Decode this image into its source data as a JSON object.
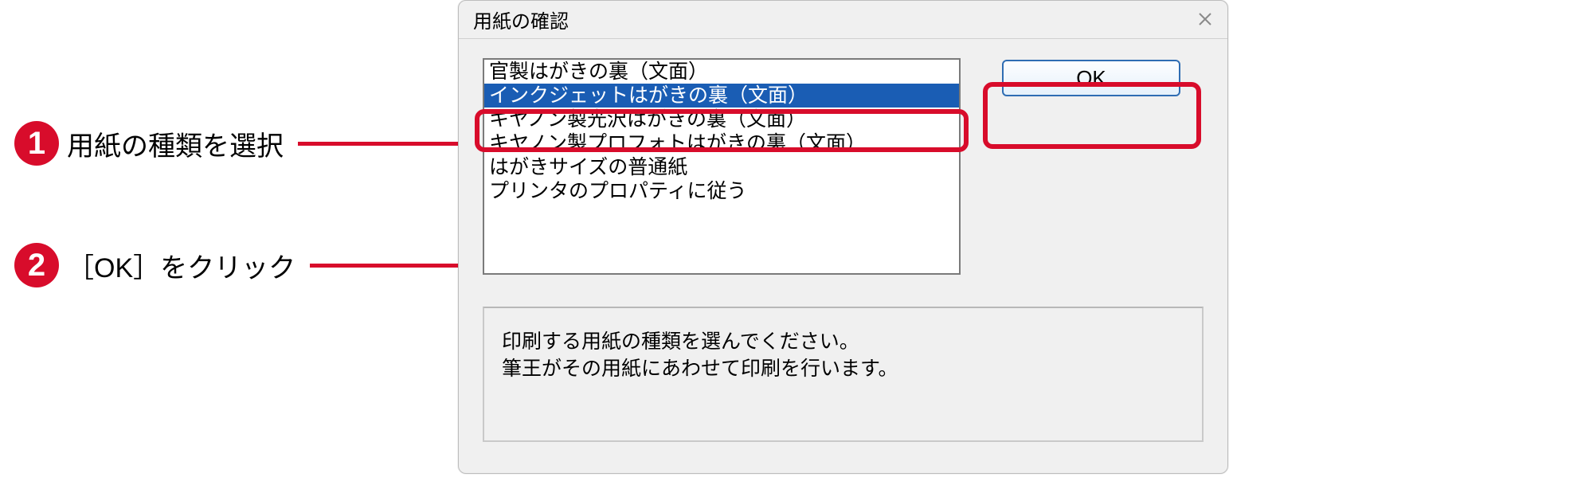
{
  "callouts": [
    {
      "num": "1",
      "text": "用紙の種類を選択"
    },
    {
      "num": "2",
      "text": "［OK］をクリック"
    }
  ],
  "dialog": {
    "title": "用紙の確認",
    "close_icon": "close",
    "ok_label": "OK",
    "info_line1": "印刷する用紙の種類を選んでください。",
    "info_line2": "筆王がその用紙にあわせて印刷を行います。",
    "list": {
      "items": [
        {
          "label": "官製はがきの裏（文面）",
          "selected": false
        },
        {
          "label": "インクジェットはがきの裏（文面）",
          "selected": true
        },
        {
          "label": "キヤノン製光沢はがきの裏（文面）",
          "selected": false
        },
        {
          "label": "キヤノン製プロフォトはがきの裏（文面）",
          "selected": false
        },
        {
          "label": "はがきサイズの普通紙",
          "selected": false
        },
        {
          "label": "プリンタのプロパティに従う",
          "selected": false
        }
      ]
    }
  }
}
